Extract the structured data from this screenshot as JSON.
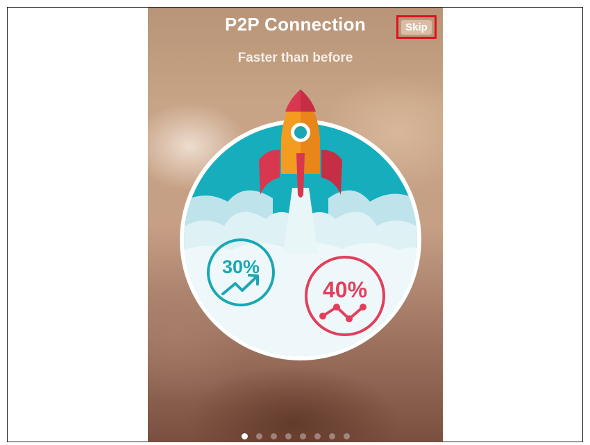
{
  "screen": {
    "title": "P2P Connection",
    "subtitle": "Faster than before",
    "skip_label": "Skip"
  },
  "stats": [
    {
      "value": "30%",
      "icon": "trend-up-arrow-icon",
      "color": "#1aa7b4"
    },
    {
      "value": "40%",
      "icon": "line-graph-icon",
      "color": "#e23f5c"
    }
  ],
  "pager": {
    "total_pages": 8,
    "active_index": 0
  },
  "colors": {
    "highlight_border": "#e0101a",
    "sky": "#18b0bf",
    "rocket_body": "#f39c1f",
    "rocket_fins": "#d8374f"
  }
}
